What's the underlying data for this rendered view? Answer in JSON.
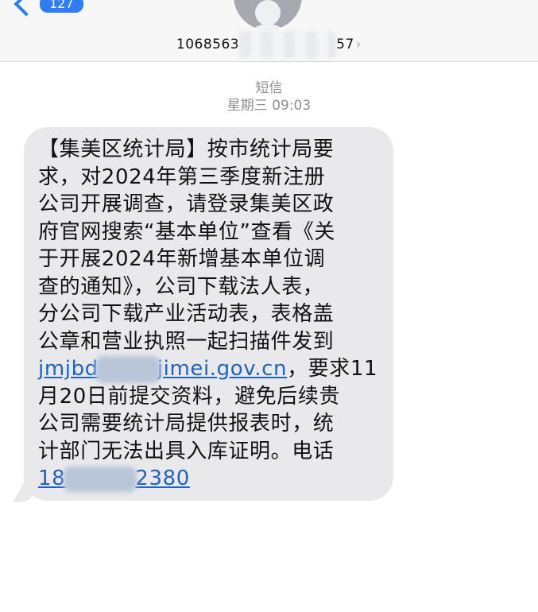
{
  "header": {
    "back_badge": "127",
    "contact_prefix": "1068563",
    "contact_suffix": "57",
    "contact_chevron": "›"
  },
  "meta": {
    "service": "短信",
    "timestamp": "星期三 09:03"
  },
  "message": {
    "lines": [
      "【集美区统计局】按市统计局要",
      "求，对2024年第三季度新注册",
      "公司开展调查，请登录集美区政",
      "府官网搜索“基本单位”查看《关",
      "于开展2024年新增基本单位调",
      "查的通知》，公司下载法人表，",
      "分公司下载产业活动表，表格盖",
      "公章和营业执照一起扫描件发到"
    ],
    "email_prefix": "jmjbd",
    "email_suffix": "jimei.gov.cn",
    "after_email": "，要求11",
    "lines_after": [
      "月20日前提交资料，避免后续贵",
      "公司需要统计局提供报表时，统",
      "计部门无法出具入库证明。电话"
    ],
    "phone_prefix": "18",
    "phone_suffix": "2380"
  },
  "colors": {
    "accent": "#2f7cf6",
    "bubble": "#e9e9eb",
    "link": "#1e63c4",
    "meta_text": "#8e8e93"
  }
}
